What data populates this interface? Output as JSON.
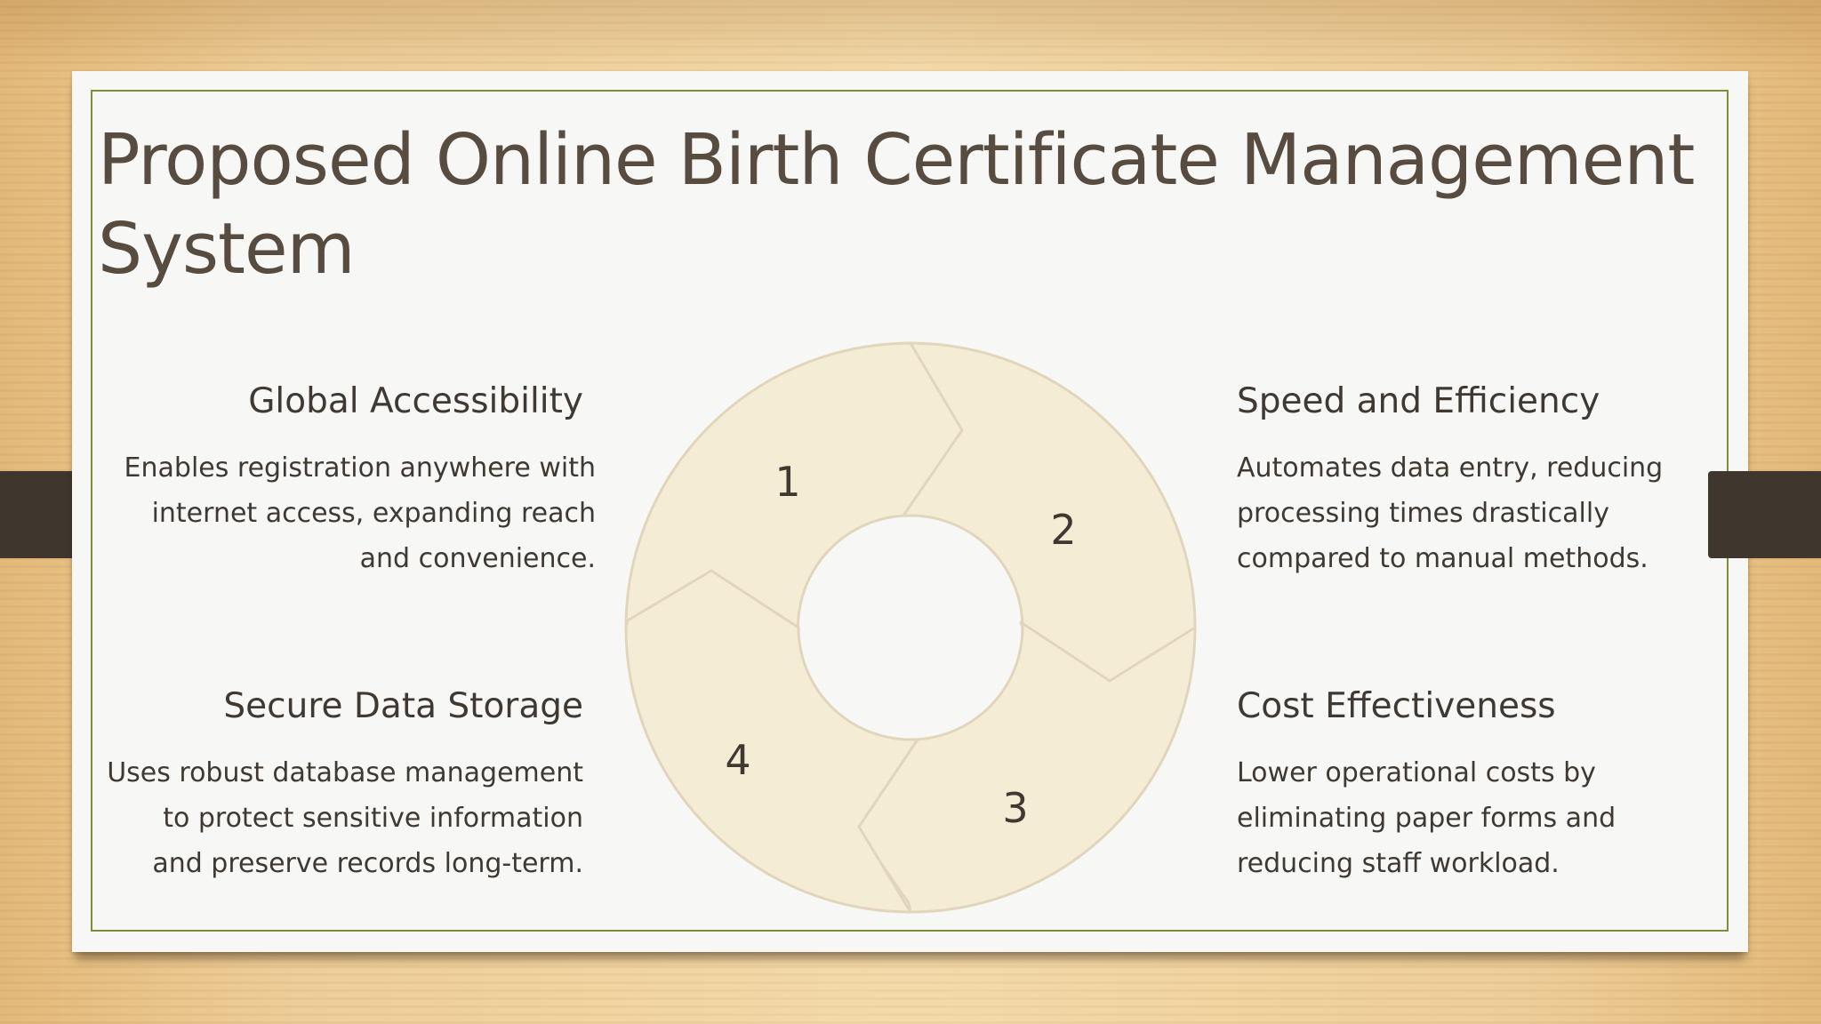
{
  "slide": {
    "title": "Proposed Online Birth Certificate Management System"
  },
  "features": [
    {
      "heading": "Global Accessibility",
      "description": "Enables registration anywhere with internet access, expanding reach and convenience."
    },
    {
      "heading": "Speed and Efficiency",
      "description": "Automates data entry, reducing processing times drastically compared to manual methods."
    },
    {
      "heading": "Secure Data Storage",
      "description": "Uses robust database management to protect sensitive information and preserve records long-term."
    },
    {
      "heading": "Cost Effectiveness",
      "description": "Lower operational costs by eliminating paper forms and reducing staff workload."
    }
  ],
  "cycle": {
    "numbers": [
      "1",
      "2",
      "3",
      "4"
    ],
    "segment_fill": "#f5ecd5",
    "segment_stroke": "#e1d6bb"
  },
  "colors": {
    "title": "#574c3f",
    "text": "#3f3932",
    "frame": "#7c8f3a",
    "tab": "#3f372d"
  }
}
